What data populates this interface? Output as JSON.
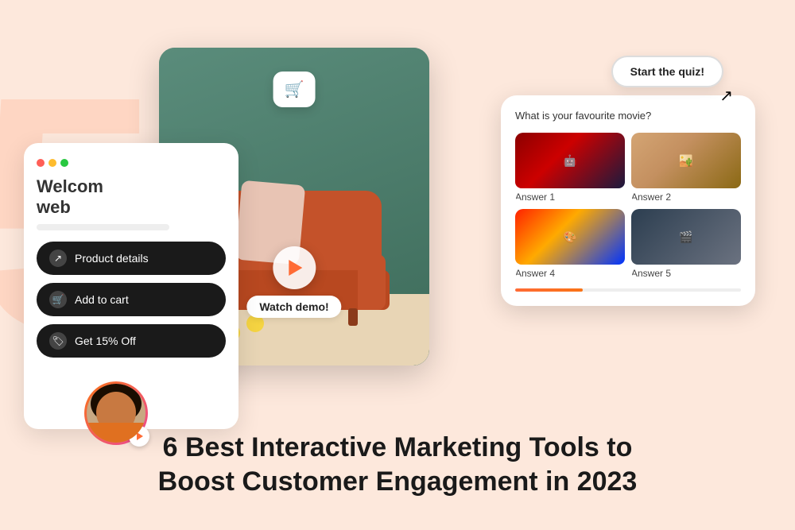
{
  "background": {
    "decorative_number": "5"
  },
  "left_panel": {
    "browser_dots": [
      "red",
      "yellow",
      "green"
    ],
    "welcome_text": "Welcom web",
    "menu_items": [
      {
        "id": "product-details",
        "label": "Product details",
        "icon": "share-icon"
      },
      {
        "id": "add-to-cart",
        "label": "Add to cart",
        "icon": "cart-icon"
      },
      {
        "id": "discount",
        "label": "Get 15% Off",
        "icon": "tag-icon"
      }
    ]
  },
  "center_panel": {
    "watch_demo_label": "Watch demo!"
  },
  "right_panel": {
    "quiz_question": "What is your favourite movie?",
    "answers": [
      {
        "id": "answer-1",
        "label": "Answer 1"
      },
      {
        "id": "answer-2",
        "label": "Answer 2"
      },
      {
        "id": "answer-4",
        "label": "Answer 4"
      },
      {
        "id": "answer-5",
        "label": "Answer 5"
      }
    ],
    "progress_percent": 30
  },
  "start_quiz_button": {
    "label": "Start the quiz!"
  },
  "bottom_title": {
    "line1": "6 Best Interactive Marketing Tools to",
    "line2": "Boost Customer Engagement in 2023"
  }
}
